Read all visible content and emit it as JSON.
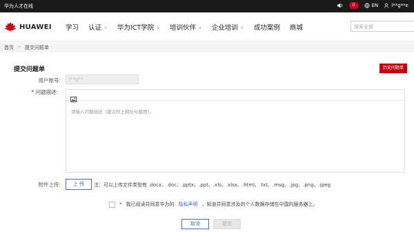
{
  "topbar": {
    "site_name": "华为人才在线",
    "notif_count": "0",
    "lang": "EN",
    "username": "l**g**e"
  },
  "nav": {
    "logo": "HUAWEI",
    "items": [
      {
        "label": "学习",
        "caret": false
      },
      {
        "label": "认证",
        "caret": true
      },
      {
        "label": "华为ICT学院",
        "caret": true
      },
      {
        "label": "培训伙伴",
        "caret": true
      },
      {
        "label": "企业培训",
        "caret": true
      },
      {
        "label": "成功案例",
        "caret": false
      },
      {
        "label": "商城",
        "caret": false
      }
    ],
    "search_placeholder": "搜索全部",
    "caret_glyph": "⌄"
  },
  "breadcrumb": {
    "home": "首页",
    "sep": ">",
    "current": "提交问题单"
  },
  "form": {
    "title": "提交问题单",
    "history_button": "历史问题单",
    "account_label": "用户账号:",
    "account_value": "l**g**",
    "description_label": "问题描述:",
    "description_required": "*",
    "description_placeholder": "请输入问题描述（建议附上网址与截图）。",
    "attachment_label": "附件上传:",
    "upload_button": "上 传",
    "upload_note": "注：可以上传文件类型有 .docx、.doc、.pptx、.ppt、.xls、.xlsx、.html、.txt、.msg、.jpg、.png、.jpeg",
    "agree_star": "*",
    "agree_pre": "我已阅读并同意华为的",
    "agree_link": "隐私声明",
    "agree_post": "，知道并同意涉及的个人数据存储在中国的服务器上。",
    "cancel_button": "取消",
    "submit_button": "提交"
  },
  "colors": {
    "brand_red": "#c7000b",
    "link_blue": "#3a6fc9"
  }
}
